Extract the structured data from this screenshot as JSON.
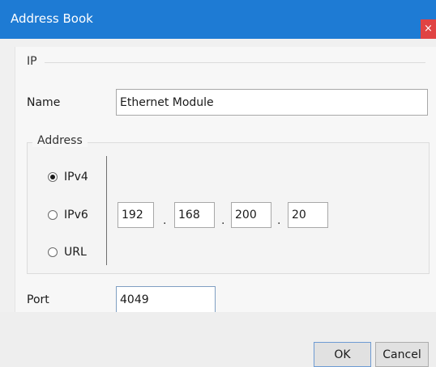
{
  "window": {
    "title": "Address Book",
    "close_glyph": "×"
  },
  "ip_group": {
    "caption": "IP"
  },
  "name": {
    "label": "Name",
    "value": "Ethernet Module"
  },
  "address_group": {
    "caption": "Address",
    "options": [
      {
        "label": "IPv4",
        "checked": true
      },
      {
        "label": "IPv6",
        "checked": false
      },
      {
        "label": "URL",
        "checked": false
      }
    ],
    "octets": [
      "192",
      "168",
      "200",
      "20"
    ],
    "separator": "."
  },
  "port": {
    "label": "Port",
    "value": "4049"
  },
  "buttons": {
    "ok": "OK",
    "cancel": "Cancel"
  },
  "colors": {
    "titlebar": "#1e7bd4",
    "close": "#e04343"
  }
}
